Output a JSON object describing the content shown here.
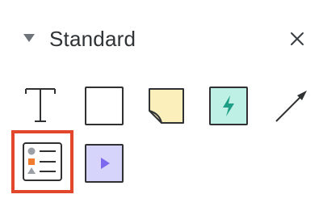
{
  "panel": {
    "title": "Standard"
  },
  "icons": {
    "collapse": "collapse-triangle-icon",
    "close": "close-icon"
  },
  "shapes": [
    {
      "name": "text",
      "icon": "text-icon"
    },
    {
      "name": "rectangle",
      "icon": "rectangle-icon"
    },
    {
      "name": "sticky-note",
      "icon": "sticky-note-icon",
      "color": "#fbefbc"
    },
    {
      "name": "action",
      "icon": "lightning-icon",
      "color": "#bff0e6"
    },
    {
      "name": "arrow-line",
      "icon": "arrow-icon"
    },
    {
      "name": "list",
      "icon": "list-icon",
      "selected": true,
      "highlight_color": "#e2472b"
    },
    {
      "name": "video",
      "icon": "play-icon",
      "color": "#d6d4fb"
    }
  ]
}
